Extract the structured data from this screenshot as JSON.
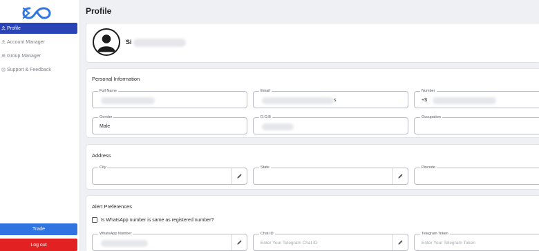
{
  "sidebar": {
    "items": [
      {
        "label": "Profile",
        "icon": "user-icon",
        "active": true
      },
      {
        "label": "Account Manager",
        "icon": "account-icon",
        "active": false
      },
      {
        "label": "Group Manager",
        "icon": "group-icon",
        "active": false
      },
      {
        "label": "Support & Feedback",
        "icon": "support-icon",
        "active": false
      }
    ],
    "trade_label": "Trade",
    "logout_label": "Log out"
  },
  "page": {
    "title": "Profile"
  },
  "profile": {
    "name_visible": "Si"
  },
  "personal": {
    "title": "Personal Information",
    "full_name": {
      "label": "Full Name",
      "value": ""
    },
    "email": {
      "label": "Email",
      "value": "s"
    },
    "number": {
      "label": "Number",
      "value": "+$"
    },
    "gender": {
      "label": "Gender",
      "value": "Male"
    },
    "dob": {
      "label": "D.O.B",
      "value": ""
    },
    "occupation": {
      "label": "Occupation",
      "value": ""
    }
  },
  "address": {
    "title": "Address",
    "city": {
      "label": "City",
      "value": ""
    },
    "state": {
      "label": "State",
      "value": ""
    },
    "pincode": {
      "label": "Pincode",
      "value": ""
    }
  },
  "alerts": {
    "title": "Alert Preferences",
    "whatsapp_same_label": "Is WhatsApp number is same as registered number?",
    "whatsapp_number": {
      "label": "WhatsApp Number",
      "value": ""
    },
    "chat_id": {
      "label": "Chat ID",
      "placeholder": "Enter Your Telegram Chat ID"
    },
    "telegram_token": {
      "label": "Telegram Token",
      "placeholder": "Enter Your Telegram Token"
    }
  },
  "colors": {
    "active_nav": "#2a44b8",
    "trade": "#2f74e0",
    "logout": "#e22222",
    "logo": "#2f74e0"
  }
}
